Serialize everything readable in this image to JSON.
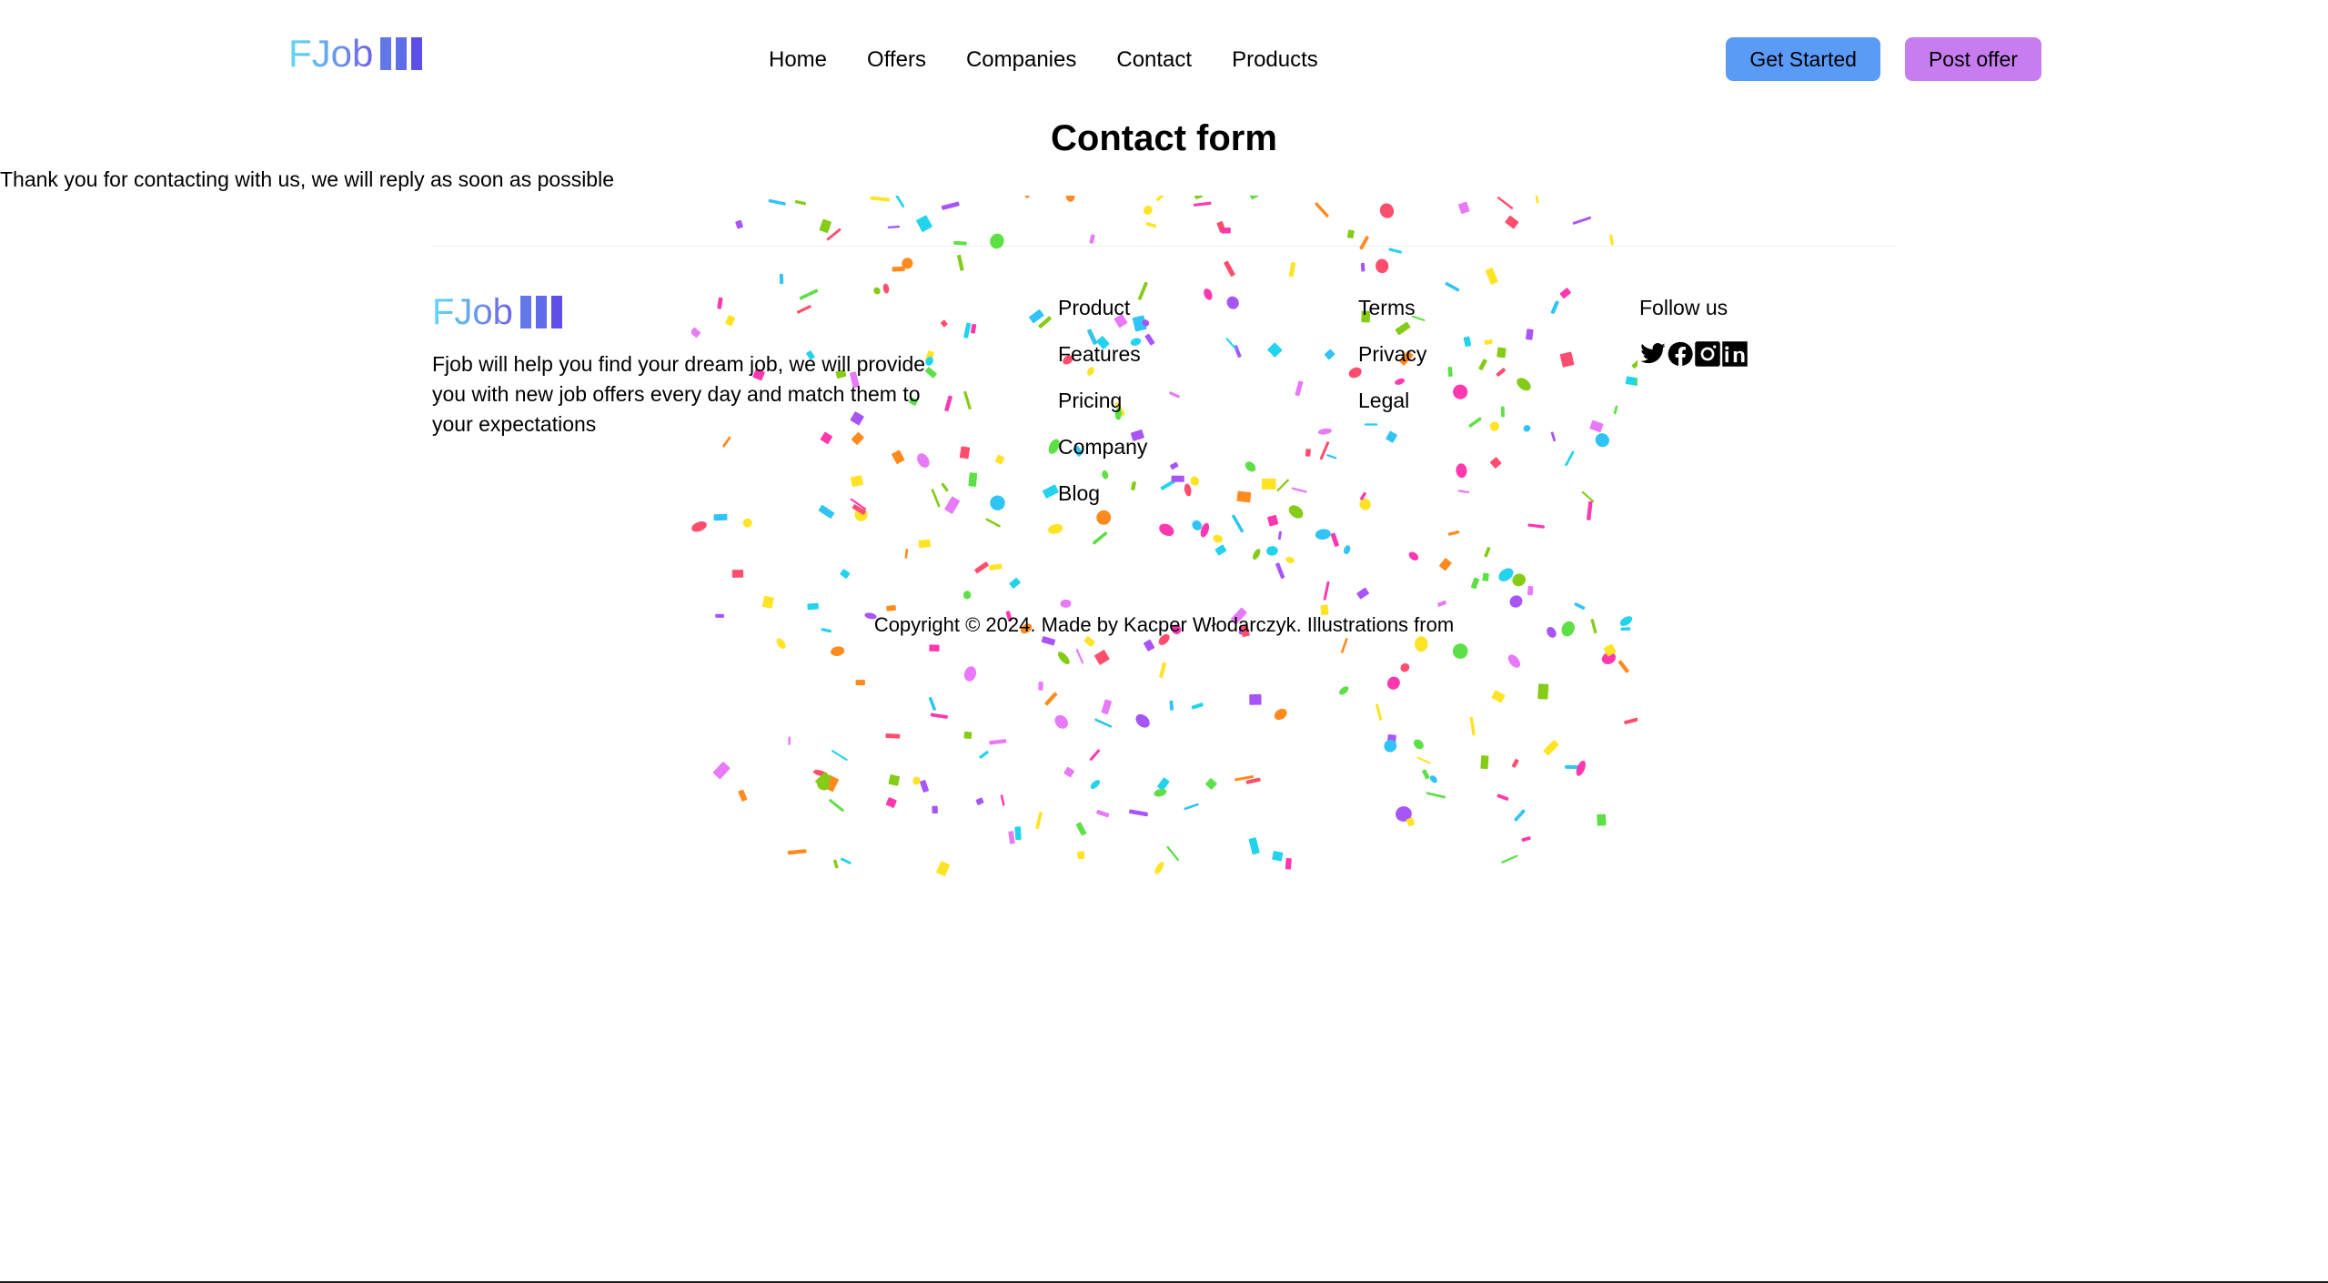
{
  "brand": {
    "name": "FJob",
    "bars_icon": "logo-bars-icon"
  },
  "header": {
    "nav": [
      {
        "label": "Home"
      },
      {
        "label": "Offers"
      },
      {
        "label": "Companies"
      },
      {
        "label": "Contact"
      },
      {
        "label": "Products"
      }
    ],
    "buttons": {
      "get_started": "Get Started",
      "post_offer": "Post offer"
    },
    "colors": {
      "get_started_bg": "#5B9BF8",
      "post_offer_bg": "#C77DF0"
    }
  },
  "main": {
    "title": "Contact form",
    "message": "Thank you for contacting with us, we will reply as soon as possible"
  },
  "footer": {
    "brand_name": "FJob",
    "description": "Fjob will help you find your dream job, we will provide you with new job offers every day and match them to your expectations",
    "columns": [
      {
        "links": [
          {
            "label": "Product"
          },
          {
            "label": "Features"
          },
          {
            "label": "Pricing"
          },
          {
            "label": "Company"
          },
          {
            "label": "Blog"
          }
        ]
      },
      {
        "links": [
          {
            "label": "Terms"
          },
          {
            "label": "Privacy"
          },
          {
            "label": "Legal"
          }
        ]
      }
    ],
    "follow": {
      "heading": "Follow us",
      "socials": [
        {
          "name": "twitter-icon"
        },
        {
          "name": "facebook-icon"
        },
        {
          "name": "instagram-icon"
        },
        {
          "name": "linkedin-icon"
        }
      ]
    },
    "copyright": "Copyright © 2024. Made by Kacper Włodarczyk. Illustrations from"
  },
  "decoration": {
    "confetti_colors": [
      "#FF38B0",
      "#2FC4F5",
      "#5CE046",
      "#FFE324",
      "#FF8A1E",
      "#A855F7",
      "#FF4D6D",
      "#22D3EE",
      "#84CC16",
      "#E879F9"
    ]
  }
}
